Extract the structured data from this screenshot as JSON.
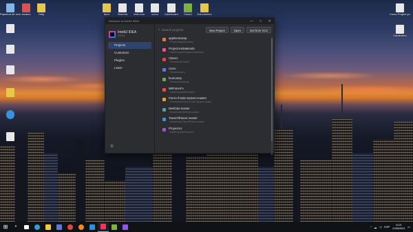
{
  "desktop": {
    "icons_left": [
      {
        "label": "Papelera de reciclaje",
        "color": "#7fb7e6"
      },
      {
        "label": "",
        "color": "#e8e8e8"
      },
      {
        "label": "",
        "color": "#e8e8e8"
      },
      {
        "label": "",
        "color": "#e8e8e8"
      },
      {
        "label": "",
        "color": "#e8c84a"
      },
      {
        "label": "",
        "color": "#e8c84a"
      },
      {
        "label": "",
        "color": "#3a8fe0"
      },
      {
        "label": "",
        "color": "#e8e8e8"
      }
    ],
    "icons_top": [
      {
        "label": "arcaico",
        "color": "#d9534f"
      },
      {
        "label": "Dirty",
        "color": "#e8c84a"
      },
      {
        "label": "docs",
        "color": "#e8c84a"
      },
      {
        "label": "Sistema",
        "color": "#e8e8e8"
      },
      {
        "label": "Instructor",
        "color": "#e8e8e8"
      },
      {
        "label": "curso",
        "color": "#e8e8e8"
      },
      {
        "label": "Dashboard",
        "color": "#e8e8e8"
      },
      {
        "label": "Clase1",
        "color": "#7cb342"
      },
      {
        "label": "Estudiantes",
        "color": "#e8c84a"
      }
    ],
    "icons_right": [
      {
        "label": "Curso Project youtube",
        "color": "#e8e8e8"
      },
      {
        "label": "Camionero",
        "color": "#e8e8e8"
      }
    ]
  },
  "window": {
    "title": "Welcome to IntelliJ IDEA",
    "controls": {
      "minimize": "—",
      "maximize": "□",
      "close": "✕"
    },
    "brand": {
      "name": "IntelliJ IDEA",
      "version": "2024.1"
    },
    "nav": [
      {
        "label": "Projects",
        "active": true
      },
      {
        "label": "Customize",
        "active": false
      },
      {
        "label": "Plugins",
        "active": false
      },
      {
        "label": "Learn",
        "active": false
      }
    ],
    "search_placeholder": "Search projects",
    "buttons": {
      "new_project": "New Project",
      "open": "Open",
      "vcs": "Get from VCS"
    },
    "projects": [
      {
        "name": "appBootcamp",
        "path": "~\\Projects\\appBootcamp",
        "color": "#e5744d"
      },
      {
        "name": "ProjectoHolaMundo",
        "path": "~\\IdeaProjects\\ProjectoHolaMundo",
        "color": "#d95a8e"
      },
      {
        "name": "Clase1",
        "path": "~\\Documents\\Clase1",
        "color": "#c84f4f"
      },
      {
        "name": "curso",
        "path": "~\\Desktop\\curso",
        "color": "#5c7bd9"
      },
      {
        "name": "bootcamp",
        "path": "~\\Desktop\\bootcamp",
        "color": "#6aab4f"
      },
      {
        "name": "MiPrimerFx",
        "path": "~\\IdeaProjects\\MiPrimerFx",
        "color": "#d9534f"
      },
      {
        "name": "Point-of-Sale-System-master",
        "path": "~\\Downloads\\Point-of-Sale-System-master",
        "color": "#d9a53f"
      },
      {
        "name": "MedOps-master",
        "path": "~\\Downloads\\MedOps-master",
        "color": "#4fa3a3"
      },
      {
        "name": "TowerOfHanoi-master",
        "path": "~\\Downloads\\TowerOfHanoi-master",
        "color": "#3f8fd9"
      },
      {
        "name": "Proyecto1",
        "path": "~\\IdeaProjects\\Proyecto1",
        "color": "#9b59b6"
      }
    ]
  },
  "taskbar": {
    "apps": [
      {
        "name": "task-view",
        "color": "#ffffff"
      },
      {
        "name": "edge",
        "color": "#2a9fd8"
      },
      {
        "name": "file-explorer",
        "color": "#f2c744"
      },
      {
        "name": "store",
        "color": "#5c7bd9"
      },
      {
        "name": "chrome",
        "color": "#e0483e"
      },
      {
        "name": "firefox",
        "color": "#f08a24"
      },
      {
        "name": "vscode",
        "color": "#2d8fd8"
      },
      {
        "name": "intellij",
        "color": "#fe315d"
      },
      {
        "name": "app-9",
        "color": "#7cb342"
      },
      {
        "name": "app-10",
        "color": "#8e5ae0"
      }
    ],
    "tray": {
      "lang": "ESP",
      "time": "10:21",
      "date": "21/06/2024"
    }
  }
}
